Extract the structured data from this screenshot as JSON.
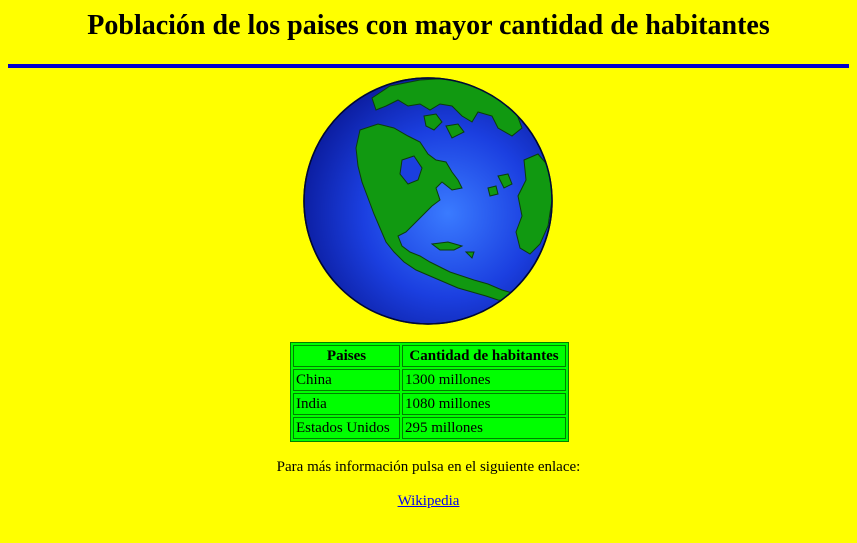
{
  "page": {
    "title": "Población de los paises con mayor cantidad de habitantes"
  },
  "colors": {
    "background": "#ffff00",
    "rule": "#0000cc",
    "table_bg": "#00ff00",
    "table_border": "#008000",
    "link": "#0000ee"
  },
  "globe": {
    "icon": "globe-icon"
  },
  "table": {
    "headers": [
      "Paises",
      "Cantidad de habitantes"
    ],
    "rows": [
      [
        "China",
        "1300 millones"
      ],
      [
        "India",
        "1080 millones"
      ],
      [
        "Estados Unidos",
        "295 millones"
      ]
    ]
  },
  "footer": {
    "info_text": "Para más información pulsa en el siguiente enlace:",
    "link_label": "Wikipedia"
  }
}
